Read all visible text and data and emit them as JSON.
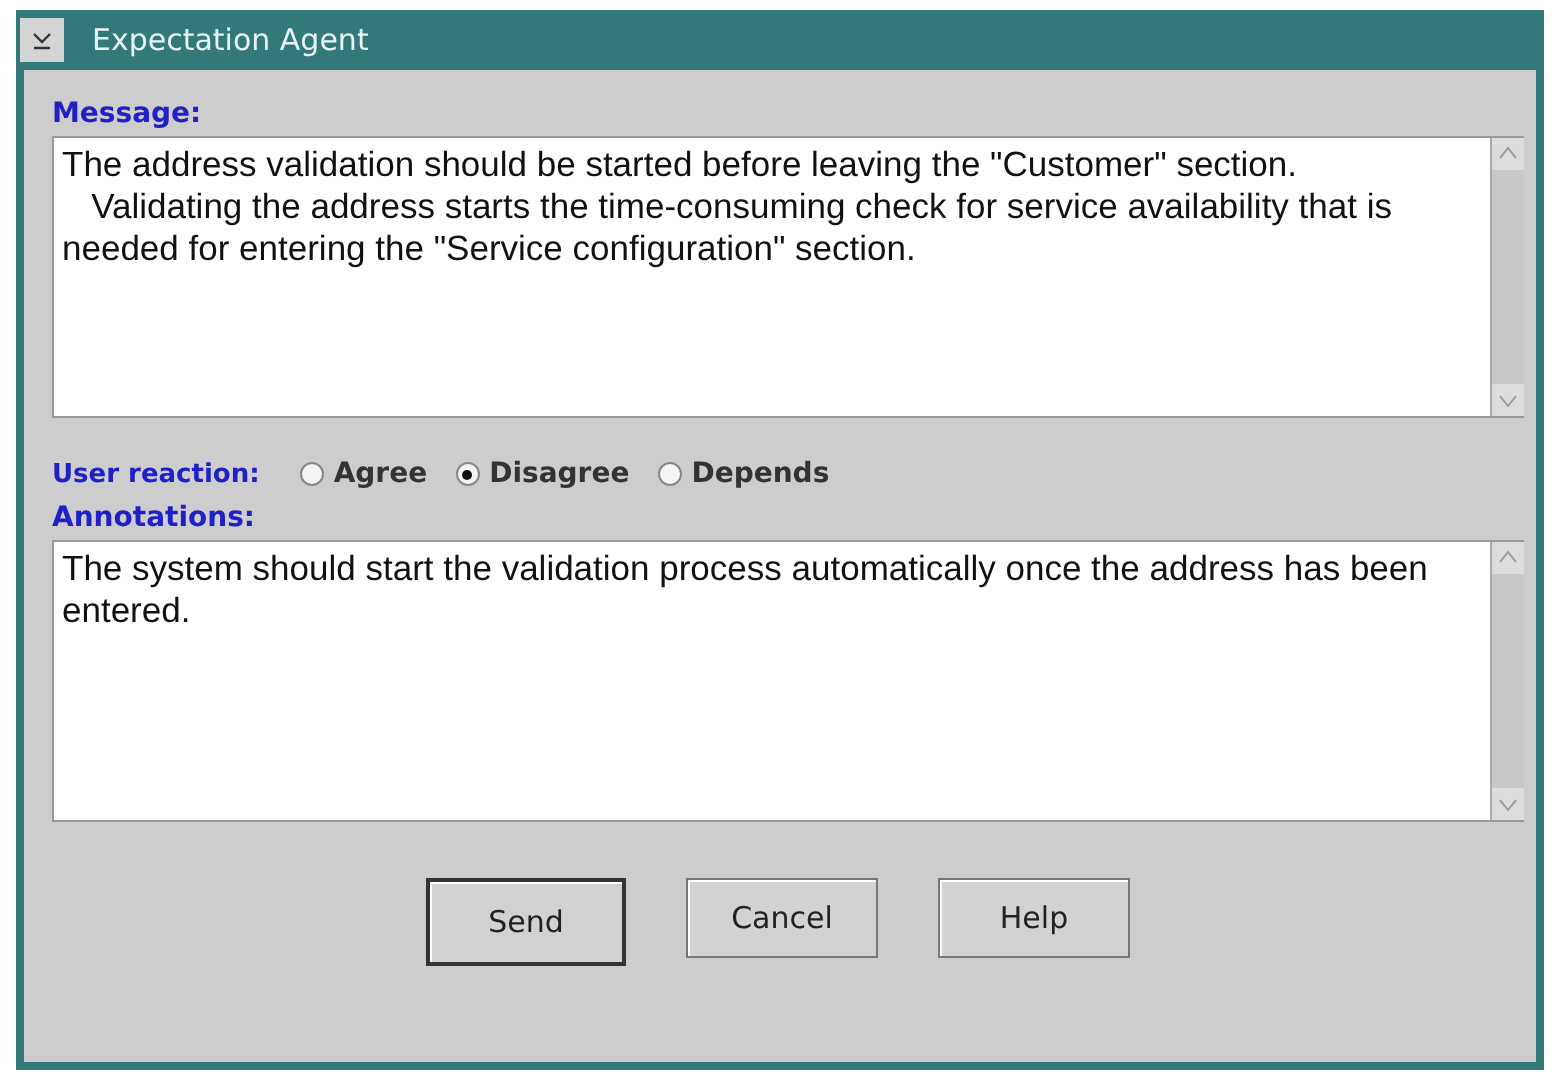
{
  "window": {
    "title": "Expectation Agent"
  },
  "message": {
    "label": "Message:",
    "paragraphs": [
      "The address validation should be started before leaving the \"Customer\" section.",
      "   Validating the address starts the time-consuming check for service availability that is needed for entering the \"Service configuration\" section."
    ]
  },
  "user_reaction": {
    "label": "User reaction:",
    "options": [
      {
        "label": "Agree",
        "selected": false
      },
      {
        "label": "Disagree",
        "selected": true
      },
      {
        "label": "Depends",
        "selected": false
      }
    ]
  },
  "annotations": {
    "label": "Annotations:",
    "value": "The system should start the validation process automatically once the address has been entered."
  },
  "buttons": [
    {
      "label": "Send",
      "default": true
    },
    {
      "label": "Cancel",
      "default": false
    },
    {
      "label": "Help",
      "default": false
    }
  ]
}
